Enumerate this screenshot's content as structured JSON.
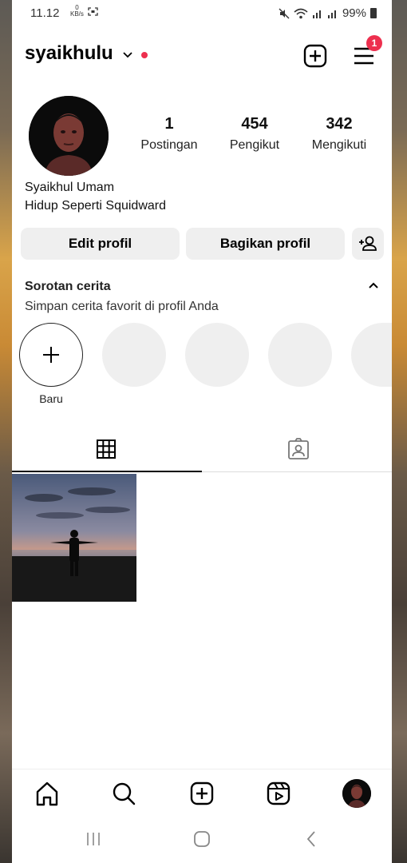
{
  "status": {
    "time": "11.12",
    "speed_value": "0",
    "speed_unit": "KB/s",
    "battery": "99%"
  },
  "header": {
    "username": "syaikhulu",
    "notification_count": "1"
  },
  "profile": {
    "posts_count": "1",
    "posts_label": "Postingan",
    "followers_count": "454",
    "followers_label": "Pengikut",
    "following_count": "342",
    "following_label": "Mengikuti",
    "full_name": "Syaikhul Umam",
    "bio": "Hidup Seperti Squidward"
  },
  "actions": {
    "edit_label": "Edit profil",
    "share_label": "Bagikan profil"
  },
  "highlights": {
    "title": "Sorotan cerita",
    "subtitle": "Simpan cerita favorit di profil Anda",
    "new_label": "Baru"
  },
  "tabs": [
    {
      "icon": "grid-icon",
      "active": true
    },
    {
      "icon": "tagged-icon",
      "active": false
    }
  ],
  "bottom_nav": [
    "home-icon",
    "search-icon",
    "create-icon",
    "reels-icon",
    "profile-avatar"
  ],
  "colors": {
    "accent_red": "#ed2f4e",
    "button_bg": "#efefef"
  }
}
